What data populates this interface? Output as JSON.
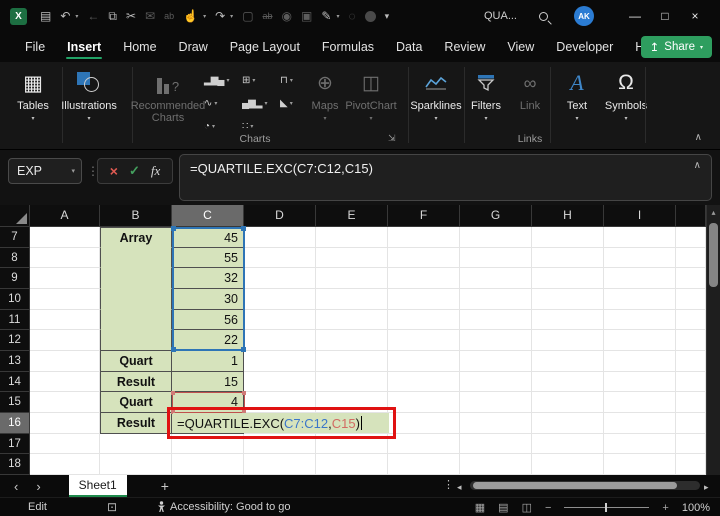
{
  "titlebar": {
    "search_text": "QUA...",
    "avatar": "AK",
    "window": {
      "minimize": "—",
      "maximize": "□",
      "close": "×"
    }
  },
  "icons": {
    "excel_logo": "X",
    "save": "▤",
    "undo": "↶",
    "back": "←",
    "paste": "⧉",
    "cut": "✂",
    "mail": "✉",
    "spelling": "ab",
    "touch": "☝",
    "redo": "↷",
    "new_doc": "▢",
    "strikethrough": "ab",
    "camera": "◉",
    "preview": "▣",
    "pen": "✎",
    "person_search": "◌",
    "dropdown": "▾",
    "share": "↥",
    "tables": "▦",
    "rec_question": "?",
    "maps": "⊕",
    "pivotchart": "◫",
    "link": "∞",
    "omega": "Ω",
    "text_a": "A",
    "launcher": "⇲",
    "ribbon_collapse": "∧",
    "formula_collapse": "∧",
    "cancel": "×",
    "enter": "✓",
    "fx": "fx",
    "dots": "⋮",
    "scroll_up": "▴",
    "sheet_prev": "‹",
    "sheet_next": "›",
    "sheet_menu": "⋮",
    "hscroll_left": "◂",
    "hscroll_right": "▸",
    "view_normal": "▦",
    "view_layout": "▤",
    "view_break": "◫",
    "macro": "⊡"
  },
  "tabs": {
    "items": [
      "File",
      "Insert",
      "Home",
      "Draw",
      "Page Layout",
      "Formulas",
      "Data",
      "Review",
      "View",
      "Developer",
      "Help"
    ],
    "active": "Insert",
    "share": "Share"
  },
  "ribbon": {
    "tables": "Tables",
    "illustrations": "Illustrations",
    "recommended_1": "Recommended",
    "recommended_2": "Charts",
    "charts_group": "Charts",
    "maps": "Maps",
    "pivotchart": "PivotChart",
    "sparklines": "Sparklines",
    "filters": "Filters",
    "link": "Link",
    "links_group": "Links",
    "text": "Text",
    "symbols": "Symbols",
    "mini_charts": [
      {
        "name": "column-chart",
        "glyph": "▂▆▄"
      },
      {
        "name": "line-chart",
        "glyph": "∿"
      },
      {
        "name": "pie-chart",
        "glyph": "◔"
      },
      {
        "name": "treemap-chart",
        "glyph": "⊞"
      },
      {
        "name": "bar-chart",
        "glyph": "▄▆▂"
      },
      {
        "name": "scatter-chart",
        "glyph": "∷"
      },
      {
        "name": "hierarchy-chart",
        "glyph": "⊓"
      },
      {
        "name": "waterfall-chart",
        "glyph": "◣"
      }
    ]
  },
  "formula_bar": {
    "name_box": "EXP",
    "formula": "=QUARTILE.EXC(C7:C12,C15)"
  },
  "grid": {
    "col_headers": [
      "A",
      "B",
      "C",
      "D",
      "E",
      "F",
      "G",
      "H",
      "I"
    ],
    "selected_col": "C",
    "selected_row": "16",
    "rows": [
      {
        "num": "7",
        "b": "Array",
        "c": "45"
      },
      {
        "num": "8",
        "b": "",
        "c": "55"
      },
      {
        "num": "9",
        "b": "",
        "c": "32"
      },
      {
        "num": "10",
        "b": "",
        "c": "30"
      },
      {
        "num": "11",
        "b": "",
        "c": "56"
      },
      {
        "num": "12",
        "b": "",
        "c": "22"
      },
      {
        "num": "13",
        "b": "Quart",
        "c": "1"
      },
      {
        "num": "14",
        "b": "Result",
        "c": "15"
      },
      {
        "num": "15",
        "b": "Quart",
        "c": "4"
      },
      {
        "num": "16",
        "b": "Result",
        "c": ""
      },
      {
        "num": "17",
        "b": "",
        "c": ""
      },
      {
        "num": "18",
        "b": "",
        "c": ""
      }
    ],
    "edit_cell": {
      "prefix": "=QUARTILE.EXC(",
      "ref1": "C7:C12",
      "comma": ",",
      "ref2": "C15",
      "suffix": ")"
    }
  },
  "sheet_bar": {
    "sheet": "Sheet1",
    "add": "+"
  },
  "status_bar": {
    "mode": "Edit",
    "accessibility": "Accessibility: Good to go",
    "zoom_minus": "−",
    "zoom_plus": "+",
    "zoom": "100%"
  },
  "colors": {
    "share_green": "#2e9e5f",
    "tab_accent_green": "#21a366",
    "cell_fill_green": "#d6e3bc",
    "range_border_blue": "#2e75b6",
    "ref_border_red": "#c0504d",
    "annotation_red": "#e01212",
    "avatar_blue": "#2b7cd3"
  }
}
